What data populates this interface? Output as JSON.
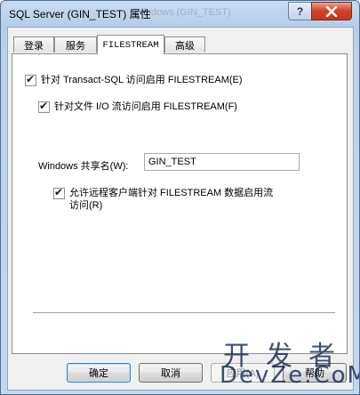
{
  "window": {
    "title": "SQL Server (GIN_TEST) 属性",
    "title_ghost": "Windows (GIN_TEST)",
    "help_label": "?"
  },
  "tabs": [
    {
      "label": "登录",
      "active": false
    },
    {
      "label": "服务",
      "active": false
    },
    {
      "label": "FILESTREAM",
      "active": true
    },
    {
      "label": "高级",
      "active": false
    }
  ],
  "filestream": {
    "enable_tsql": {
      "label": "针对 Transact-SQL 访问启用 FILESTREAM(E)",
      "checked": true
    },
    "enable_fileio": {
      "label": "针对文件 I/O 流访问启用 FILESTREAM(F)",
      "checked": true
    },
    "share_name": {
      "label": "Windows 共享名(W):",
      "value": "GIN_TEST"
    },
    "allow_remote": {
      "label": "允许远程客户端针对 FILESTREAM 数据启用流访问(R)",
      "checked": true
    }
  },
  "buttons": {
    "ok": "确定",
    "cancel": "取消",
    "apply": "应用(A)",
    "help": "帮助"
  },
  "watermark": {
    "cn": "开发者",
    "en": "DevZe.CoM"
  },
  "icons": {
    "check": "✔",
    "close": "✕"
  }
}
